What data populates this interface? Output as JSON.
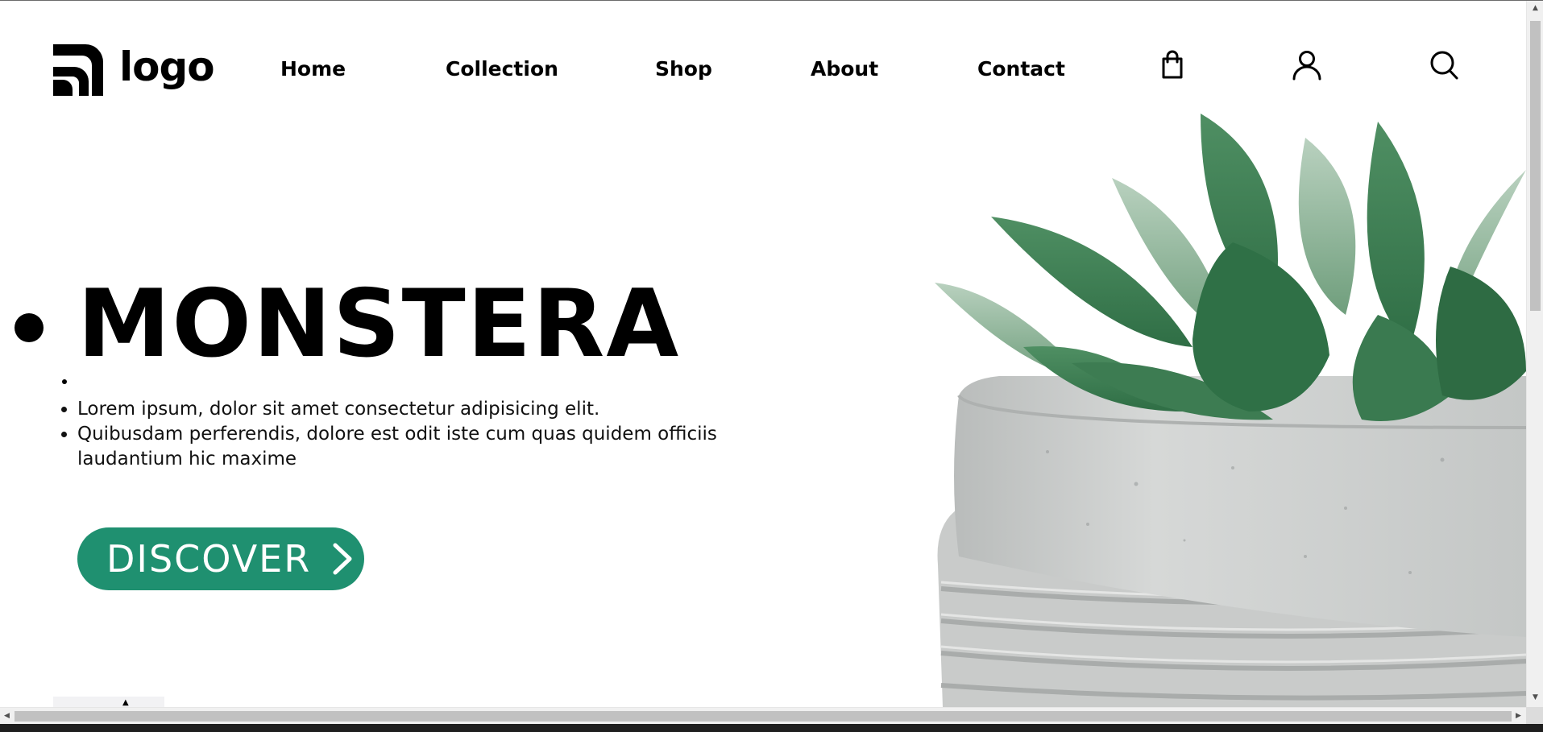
{
  "header": {
    "logo_text": "logo",
    "nav": [
      {
        "label": "Home"
      },
      {
        "label": "Collection"
      },
      {
        "label": "Shop"
      },
      {
        "label": "About"
      },
      {
        "label": "Contact"
      }
    ],
    "icons": [
      "shopping-bag-icon",
      "user-icon",
      "search-icon"
    ]
  },
  "hero": {
    "title": "MONSTERA",
    "lines": [
      "Lorem ipsum, dolor sit amet consectetur adipisicing elit.",
      "Quibusdam perferendis, dolore est odit iste cum quas quidem officiis laudantium hic maxime"
    ],
    "cta_label": "DISCOVER",
    "cta_color": "#1f9070"
  },
  "colors": {
    "accent": "#1f9070",
    "text": "#000000",
    "background": "#ffffff"
  }
}
